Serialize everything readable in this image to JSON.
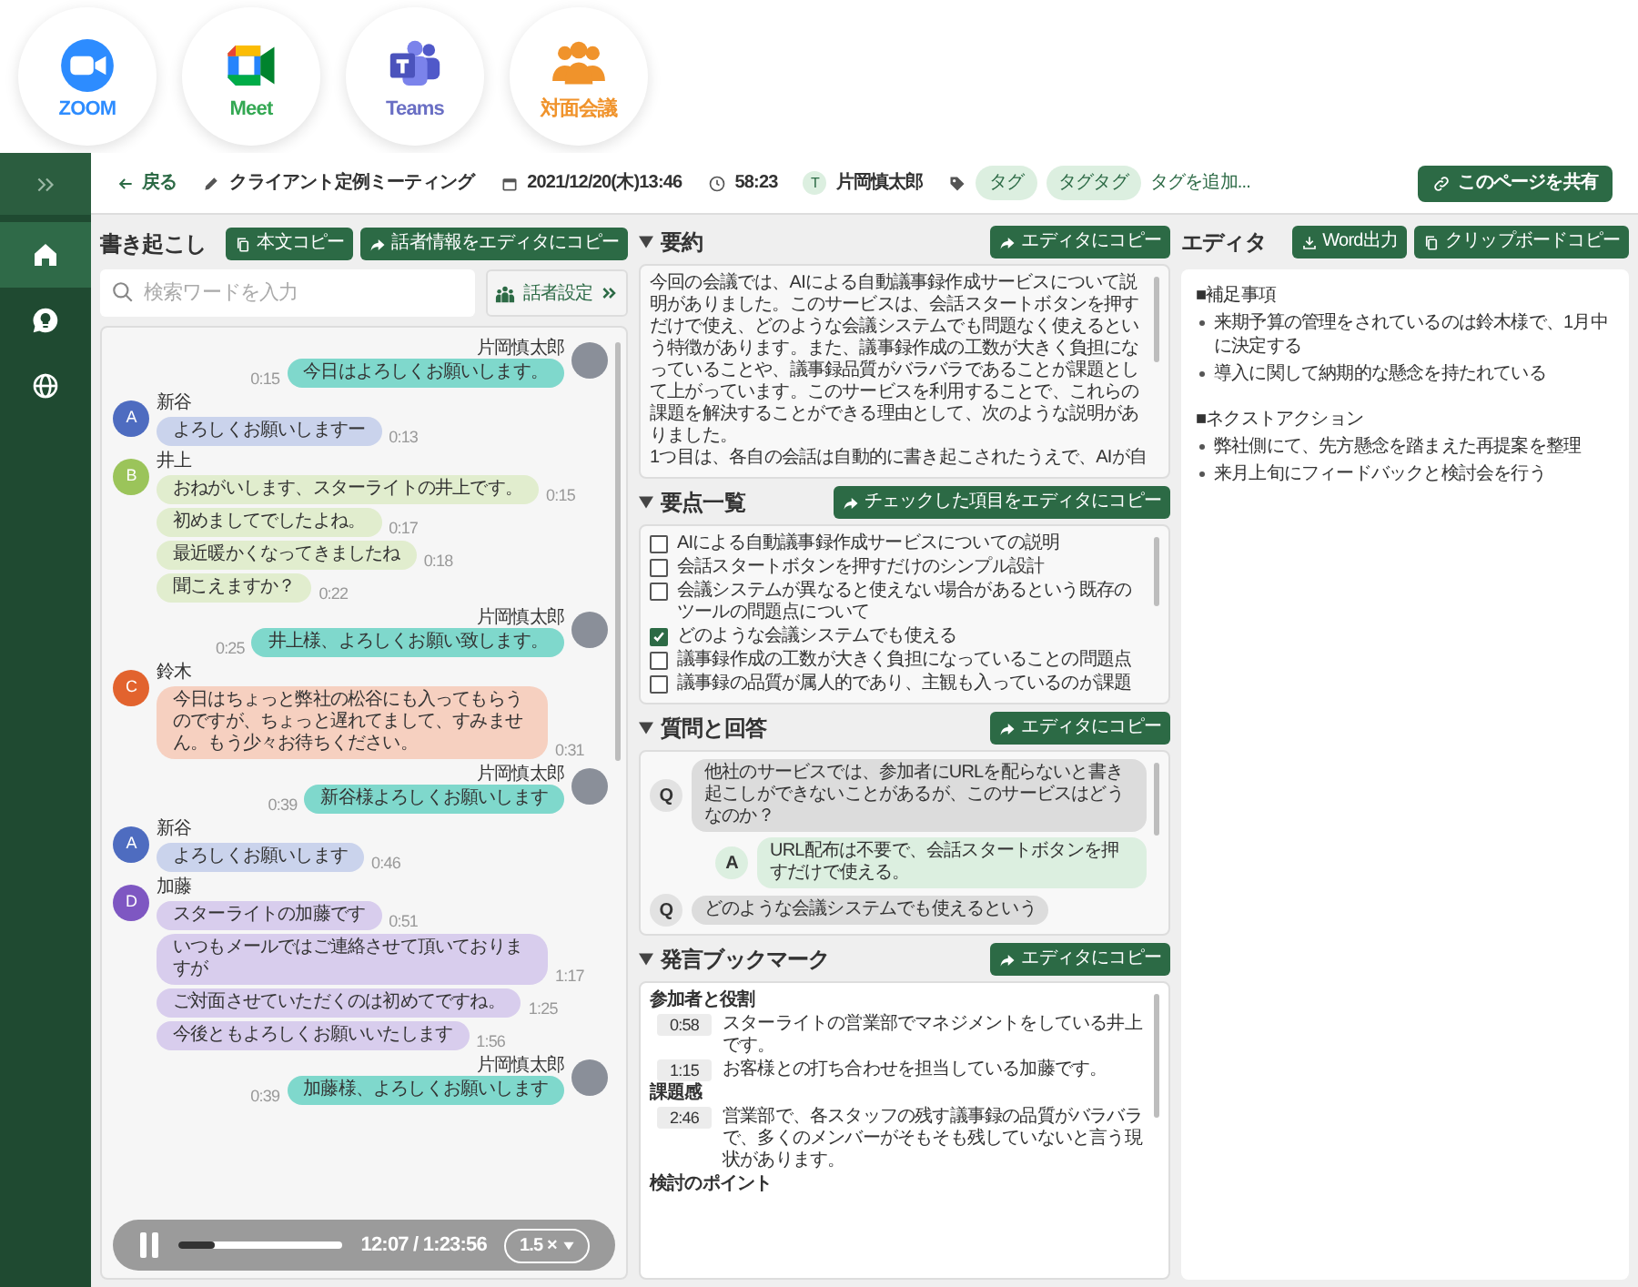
{
  "apps": [
    {
      "kind": "zoom",
      "label": "ZOOM",
      "color": "#2d8cff"
    },
    {
      "kind": "meet",
      "label": "Meet",
      "color": "#34a853"
    },
    {
      "kind": "teams",
      "label": "Teams",
      "color": "#6a6fc4"
    },
    {
      "kind": "in_person",
      "label": "対面会議",
      "color": "#f0932b"
    }
  ],
  "sidebar": {
    "items": [
      {
        "kind": "home",
        "selected": true
      },
      {
        "kind": "ideas",
        "selected": false
      },
      {
        "kind": "globe",
        "selected": false
      }
    ]
  },
  "header": {
    "back": "戻る",
    "title": "クライアント定例ミーティング",
    "datetime": "2021/12/20(木)13:46",
    "duration": "58:23",
    "owner_initial": "T",
    "owner": "片岡慎太郎",
    "tags": [
      "タグ",
      "タグタグ"
    ],
    "tag_placeholder": "タグを追加...",
    "share": "このページを共有"
  },
  "transcript": {
    "title": "書き起こし",
    "buttons": [
      {
        "kind": "copy",
        "label": "本文コピー"
      },
      {
        "kind": "send",
        "label": "話者情報をエディタにコピー"
      }
    ],
    "search": {
      "placeholder": "検索ワードを入力"
    },
    "speaker_settings": "話者設定",
    "groups": [
      {
        "kind": "self",
        "speaker": "片岡慎太郎",
        "lines": [
          {
            "text": "今日はよろしくお願いします。",
            "time": "0:15"
          }
        ]
      },
      {
        "kind": "other",
        "speaker": "新谷",
        "initial": "A",
        "color": "#4e6cc0",
        "lines": [
          {
            "text": "よろしくお願いしますー",
            "time": "0:13"
          }
        ]
      },
      {
        "kind": "other",
        "speaker": "井上",
        "initial": "B",
        "color": "#9bc45a",
        "lines": [
          {
            "text": "おねがいします、スターライトの井上です。",
            "time": "0:15"
          },
          {
            "text": "初めましてでしたよね。",
            "time": "0:17"
          },
          {
            "text": "最近暖かくなってきましたね",
            "time": "0:18"
          },
          {
            "text": "聞こえますか？",
            "time": "0:22"
          }
        ]
      },
      {
        "kind": "self",
        "speaker": "片岡慎太郎",
        "lines": [
          {
            "text": "井上様、よろしくお願い致します。",
            "time": "0:25"
          }
        ]
      },
      {
        "kind": "other",
        "speaker": "鈴木",
        "initial": "C",
        "color": "#e2632e",
        "lines": [
          {
            "text": "今日はちょっと弊社の松谷にも入ってもらうのですが、ちょっと遅れてまして、すみません。もう少々お待ちください。",
            "time": "0:31"
          }
        ]
      },
      {
        "kind": "self",
        "speaker": "片岡慎太郎",
        "lines": [
          {
            "text": "新谷様よろしくお願いします",
            "time": "0:39"
          }
        ]
      },
      {
        "kind": "other",
        "speaker": "新谷",
        "initial": "A",
        "color": "#4e6cc0",
        "lines": [
          {
            "text": "よろしくお願いします",
            "time": "0:46"
          }
        ]
      },
      {
        "kind": "other",
        "speaker": "加藤",
        "initial": "D",
        "color": "#7e57c2",
        "lines": [
          {
            "text": "スターライトの加藤です",
            "time": "0:51"
          },
          {
            "text": "いつもメールではご連絡させて頂いておりますが",
            "time": "1:17"
          },
          {
            "text": "ご対面させていただくのは初めてですね。",
            "time": "1:25"
          },
          {
            "text": "今後ともよろしくお願いいたします",
            "time": "1:56"
          }
        ]
      },
      {
        "kind": "self",
        "speaker": "片岡慎太郎",
        "lines": [
          {
            "text": "加藤様、よろしくお願いします",
            "time": "0:39"
          }
        ]
      }
    ],
    "player": {
      "playing": true,
      "level": 0.22,
      "time": "12:07 / 1:23:56",
      "speed": "1.5 ×"
    }
  },
  "summary": {
    "title": "要約",
    "button": "エディタにコピー",
    "paragraphs": [
      "今回の会議では、AIによる自動議事録作成サービスについて説明がありました。このサービスは、会話スタートボタンを押すだけで使え、どのような会議システムでも問題なく使えるという特徴があります。また、議事録作成の工数が大きく負担になっていることや、議事録品質がバラバラであることが課題として上がっています。このサービスを利用することで、これらの課題を解決することができる理由として、次のような説明がありました。",
      "1つ目は、各自の会話は自動的に書き起こされたうえで、AIが自"
    ]
  },
  "key_points": {
    "title": "要点一覧",
    "button": "チェックした項目をエディタにコピー",
    "items": [
      {
        "text": "AIによる自動議事録作成サービスについての説明",
        "checked": false
      },
      {
        "text": "会話スタートボタンを押すだけのシンプル設計",
        "checked": false
      },
      {
        "text": "会議システムが異なると使えない場合があるという既存のツールの問題点について",
        "checked": false
      },
      {
        "text": "どのような会議システムでも使える",
        "checked": true
      },
      {
        "text": "議事録作成の工数が大きく負担になっていることの問題点",
        "checked": false
      },
      {
        "text": "議事録の品質が属人的であり、主観も入っているのが課題",
        "checked": false
      }
    ]
  },
  "qa": {
    "title": "質問と回答",
    "button": "エディタにコピー",
    "items": [
      {
        "kind": "question",
        "label": "Q",
        "text": "他社のサービスでは、参加者にURLを配らないと書き起こしができないことがあるが、このサービスはどうなのか？"
      },
      {
        "kind": "answer",
        "label": "A",
        "text": "URL配布は不要で、会話スタートボタンを押すだけで使える。"
      },
      {
        "kind": "question",
        "label": "Q",
        "text": "どのような会議システムでも使えるという"
      }
    ]
  },
  "bookmarks": {
    "title": "発言ブックマーク",
    "button": "エディタにコピー",
    "sections": [
      {
        "heading": "参加者と役割",
        "entries": [
          {
            "time": "0:58",
            "text": "スターライトの営業部でマネジメントをしている井上です。"
          },
          {
            "time": "1:15",
            "text": "お客様との打ち合わせを担当している加藤です。"
          }
        ]
      },
      {
        "heading": "課題感",
        "entries": [
          {
            "time": "2:46",
            "text": "営業部で、各スタッフの残す議事録の品質がバラバラで、多くのメンバーがそもそも残していないと言う現状があります。"
          }
        ]
      },
      {
        "heading": "検討のポイント"
      }
    ]
  },
  "editor": {
    "title": "エディタ",
    "buttons": [
      {
        "kind": "download",
        "label": "Word出力"
      },
      {
        "kind": "copy",
        "label": "クリップボードコピー"
      }
    ],
    "sections": [
      {
        "heading": "■補足事項",
        "bullets": [
          "来期予算の管理をされているのは鈴木様で、1月中に決定する",
          "導入に関して納期的な懸念を持たれている"
        ]
      },
      {
        "heading": "■ネクストアクション",
        "bullets": [
          "弊社側にて、先方懸念を踏まえた再提案を整理",
          "来月上旬にフィードバックと検討会を行う"
        ]
      }
    ]
  }
}
